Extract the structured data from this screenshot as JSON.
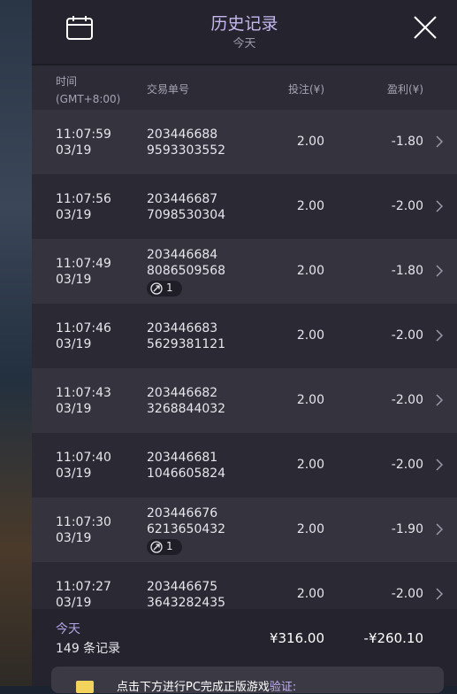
{
  "header": {
    "title": "历史记录",
    "subtitle": "今天"
  },
  "columns": {
    "time_line1": "时间",
    "time_line2": "(GMT+8:00)",
    "order": "交易单号",
    "bet": "投注(¥)",
    "profit": "盈利(¥)"
  },
  "rows": [
    {
      "time": "11:07:59",
      "date": "03/19",
      "order1": "203446688",
      "order2": "9593303552",
      "bet": "2.00",
      "profit": "-1.80",
      "badge": null
    },
    {
      "time": "11:07:56",
      "date": "03/19",
      "order1": "203446687",
      "order2": "7098530304",
      "bet": "2.00",
      "profit": "-2.00",
      "badge": null
    },
    {
      "time": "11:07:49",
      "date": "03/19",
      "order1": "203446684",
      "order2": "8086509568",
      "bet": "2.00",
      "profit": "-1.80",
      "badge": "1"
    },
    {
      "time": "11:07:46",
      "date": "03/19",
      "order1": "203446683",
      "order2": "5629381121",
      "bet": "2.00",
      "profit": "-2.00",
      "badge": null
    },
    {
      "time": "11:07:43",
      "date": "03/19",
      "order1": "203446682",
      "order2": "3268844032",
      "bet": "2.00",
      "profit": "-2.00",
      "badge": null
    },
    {
      "time": "11:07:40",
      "date": "03/19",
      "order1": "203446681",
      "order2": "1046605824",
      "bet": "2.00",
      "profit": "-2.00",
      "badge": null
    },
    {
      "time": "11:07:30",
      "date": "03/19",
      "order1": "203446676",
      "order2": "6213650432",
      "bet": "2.00",
      "profit": "-1.90",
      "badge": "1"
    },
    {
      "time": "11:07:27",
      "date": "03/19",
      "order1": "203446675",
      "order2": "3643282435",
      "bet": "2.00",
      "profit": "-2.00",
      "badge": null
    }
  ],
  "footer": {
    "today": "今天",
    "count": "149 条记录",
    "total_bet": "¥316.00",
    "total_profit": "-¥260.10",
    "banner_text": "点击下方进行PC完成正版游戏",
    "banner_link": "验证:"
  },
  "icons": {
    "calendar": "calendar-icon",
    "close": "close-icon",
    "chevron": "chevron-right-icon",
    "badge": "free-spin-icon"
  },
  "colors": {
    "accent": "#c6b8ee",
    "panel": "#2a2934",
    "row_alt": "#34333e"
  }
}
